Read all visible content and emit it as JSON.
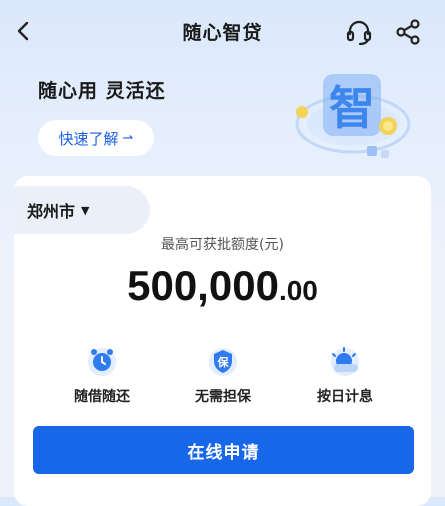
{
  "header": {
    "title": "随心智贷"
  },
  "promo": {
    "slogan": "随心用 灵活还",
    "quick_link": "快速了解",
    "logo_char": "智"
  },
  "card": {
    "city": "郑州市",
    "limit_label": "最高可获批额度(元)",
    "amount_int": "500,000",
    "amount_dec": ".00",
    "features": [
      {
        "label": "随借随还",
        "icon": "clock-icon"
      },
      {
        "label": "无需担保",
        "icon": "shield-guarantee-icon",
        "icon_char": "保"
      },
      {
        "label": "按日计息",
        "icon": "sun-cloud-icon"
      }
    ],
    "apply_label": "在线申请"
  },
  "colors": {
    "accent": "#1767e8",
    "link": "#1a5fe0",
    "icon_blue": "#2f7bf0"
  }
}
